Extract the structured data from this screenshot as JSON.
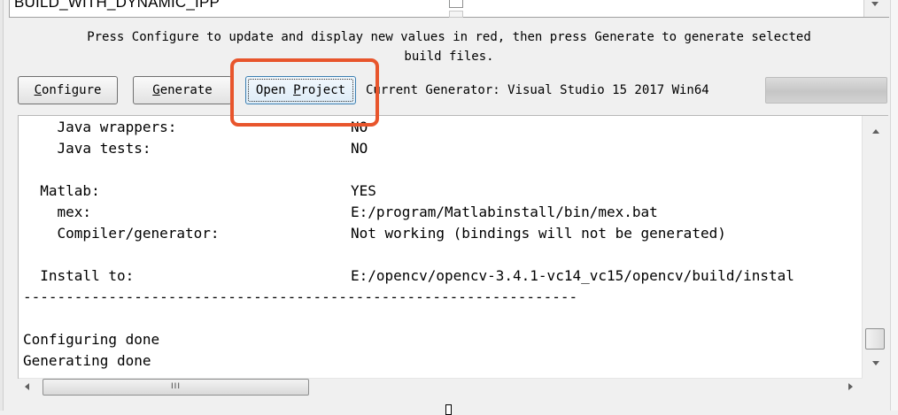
{
  "cache_table": {
    "variable_name": "BUILD_WITH_DYNAMIC_IPP"
  },
  "hint": {
    "text": "Press Configure to update and display new values in red, then press Generate to generate selected\nbuild files."
  },
  "toolbar": {
    "configure_label": "onfigure",
    "configure_mnemonic": "C",
    "generate_label": "enerate",
    "generate_mnemonic": "G",
    "open_project_prefix": "Open ",
    "open_project_mnemonic": "P",
    "open_project_suffix": "roject",
    "current_generator": "Current Generator: Visual Studio 15 2017 Win64"
  },
  "output": {
    "lines": [
      {
        "key": "    Java wrappers:",
        "value": "NO"
      },
      {
        "key": "    Java tests:",
        "value": "NO"
      },
      {
        "key": "",
        "value": ""
      },
      {
        "key": "  Matlab:",
        "value": "YES"
      },
      {
        "key": "    mex:",
        "value": "E:/program/Matlabinstall/bin/mex.bat"
      },
      {
        "key": "    Compiler/generator:",
        "value": "Not working (bindings will not be generated)"
      },
      {
        "key": "",
        "value": ""
      },
      {
        "key": "  Install to:",
        "value": "E:/opencv/opencv-3.4.1-vc14_vc15/opencv/build/instal"
      },
      {
        "key": "-----------------------------------------------------------------",
        "value": ""
      },
      {
        "key": "",
        "value": ""
      },
      {
        "key": "Configuring done",
        "value": ""
      },
      {
        "key": "Generating done",
        "value": ""
      }
    ]
  },
  "scrollbar": {
    "thumb_grip": "III"
  },
  "colors": {
    "highlight": "#e8552c",
    "window_bg": "#f0f0f0"
  }
}
